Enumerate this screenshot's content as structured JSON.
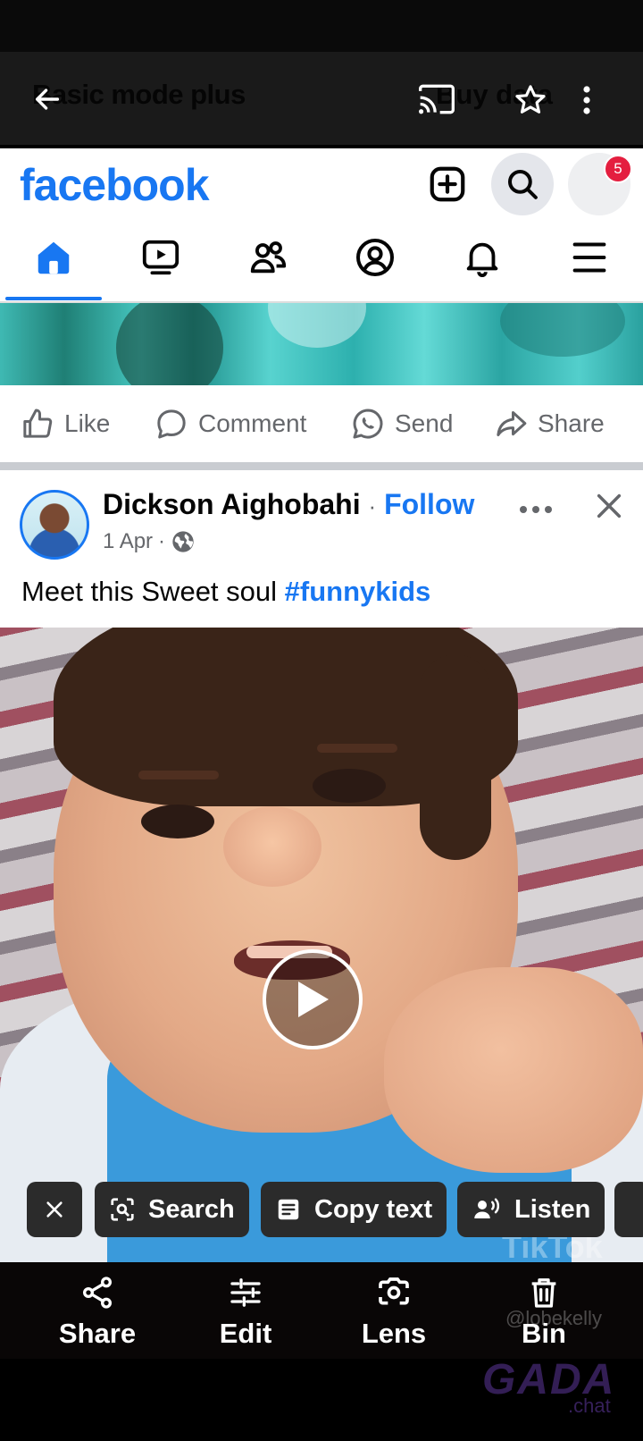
{
  "viewer": {
    "ghost_title": "Basic mode plus",
    "ghost_right": "Buy data"
  },
  "facebook": {
    "logo": "facebook",
    "notification_count": "5",
    "tabs": [
      "home",
      "video",
      "friends",
      "profile",
      "notifications",
      "menu"
    ]
  },
  "prev_post_actions": {
    "like": "Like",
    "comment": "Comment",
    "send": "Send",
    "share": "Share"
  },
  "post": {
    "author": "Dickson Aighobahi",
    "separator": "·",
    "follow": "Follow",
    "date": "1 Apr",
    "date_separator": "·",
    "caption_text": "Meet this Sweet soul ",
    "caption_tag": "#funnykids"
  },
  "lens_chips": {
    "search": "Search",
    "copy_text": "Copy text",
    "listen": "Listen"
  },
  "bottom_actions": {
    "share": "Share",
    "edit": "Edit",
    "lens": "Lens",
    "bin": "Bin"
  },
  "watermarks": {
    "tiktok": "TikTok",
    "handle": "@lobekelly",
    "gada": "GADA",
    "gada_sub": ".chat"
  },
  "colors": {
    "facebook_blue": "#1877f2",
    "badge_red": "#e41e3f",
    "chip_bg": "#2b2b2b"
  }
}
